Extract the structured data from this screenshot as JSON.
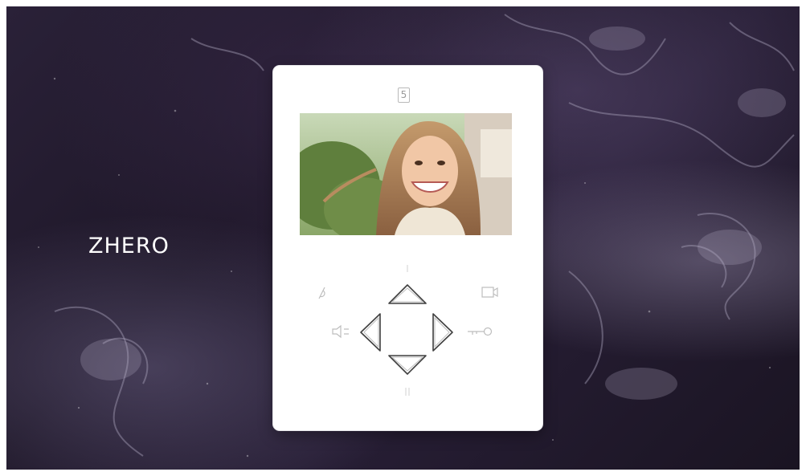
{
  "brand": {
    "name": "ZHERO"
  },
  "device": {
    "logo_glyph": "5",
    "screen": {
      "subject": "smiling-woman-camera-feed"
    },
    "keys": [
      {
        "id": "up",
        "icon": "triangle-up-icon"
      },
      {
        "id": "left",
        "icon": "triangle-left-icon"
      },
      {
        "id": "right",
        "icon": "triangle-right-icon"
      },
      {
        "id": "down",
        "icon": "triangle-down-icon"
      }
    ],
    "aux_icons": [
      "ringtone-icon",
      "monitor-icon",
      "speaker-volume-icon",
      "door-key-icon"
    ]
  },
  "colors": {
    "panel": "#ffffff",
    "key_outline": "#444444",
    "brand_text": "#ffffff"
  }
}
